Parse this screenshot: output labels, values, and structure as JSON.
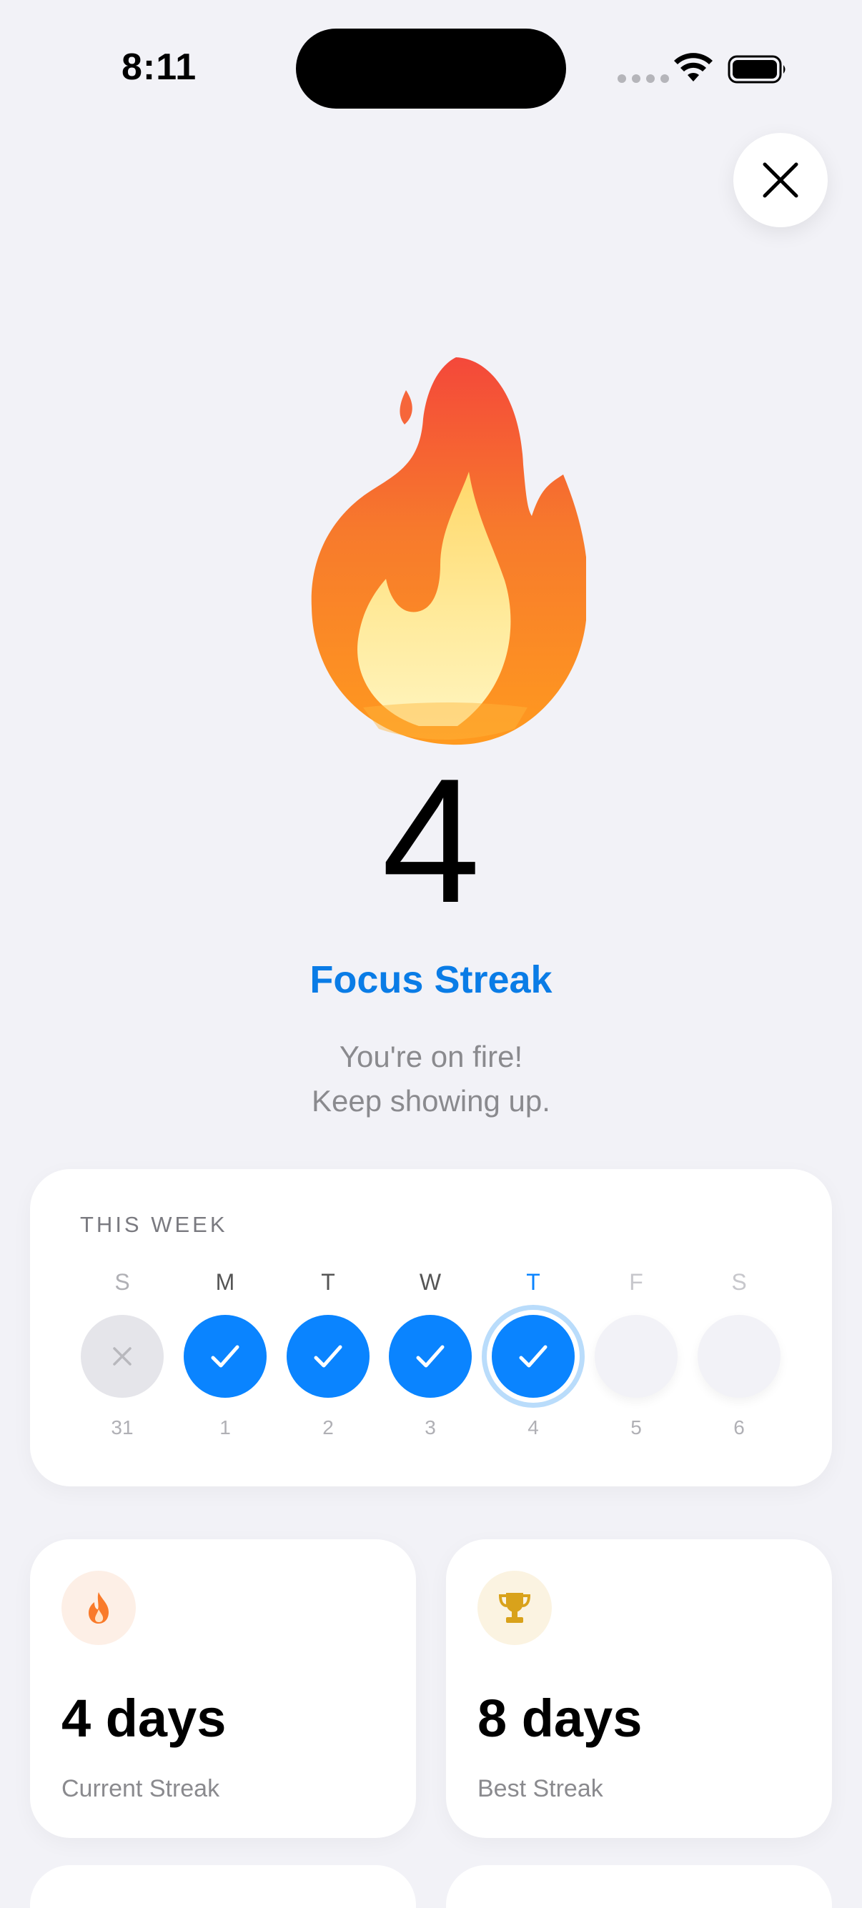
{
  "status_bar": {
    "time": "8:11"
  },
  "hero": {
    "streak_count": "4",
    "title": "Focus Streak",
    "message_line1": "You're on fire!",
    "message_line2": "Keep showing up."
  },
  "week": {
    "title": "THIS WEEK",
    "days": [
      {
        "letter": "S",
        "date": "31",
        "state": "missed"
      },
      {
        "letter": "M",
        "date": "1",
        "state": "done"
      },
      {
        "letter": "T",
        "date": "2",
        "state": "done"
      },
      {
        "letter": "W",
        "date": "3",
        "state": "done"
      },
      {
        "letter": "T",
        "date": "4",
        "state": "today"
      },
      {
        "letter": "F",
        "date": "5",
        "state": "future"
      },
      {
        "letter": "S",
        "date": "6",
        "state": "future"
      }
    ]
  },
  "stats": {
    "current": {
      "value": "4 days",
      "label": "Current Streak",
      "icon": "flame-icon"
    },
    "best": {
      "value": "8 days",
      "label": "Best Streak",
      "icon": "trophy-icon"
    }
  },
  "colors": {
    "accent": "#0A84FF",
    "title_blue": "#0A7CE6",
    "background": "#F2F2F7",
    "flame_orange": "#F97A2A",
    "trophy_gold": "#D9A21B"
  }
}
